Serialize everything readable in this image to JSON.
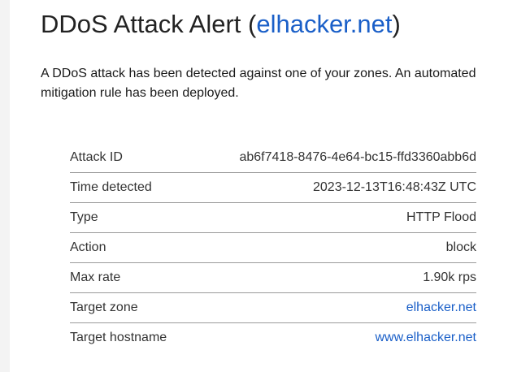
{
  "header": {
    "title_prefix": "DDoS Attack Alert (",
    "title_link": "elhacker.net",
    "title_suffix": ")"
  },
  "intro": "A DDoS attack has been detected against one of your zones. An automated mitigation rule has been deployed.",
  "details": [
    {
      "label": "Attack ID",
      "value": "ab6f7418-8476-4e64-bc15-ffd3360abb6d"
    },
    {
      "label": "Time detected",
      "value": "2023-12-13T16:48:43Z UTC"
    },
    {
      "label": "Type",
      "value": "HTTP Flood"
    },
    {
      "label": "Action",
      "value": "block"
    },
    {
      "label": "Max rate",
      "value": "1.90k rps"
    },
    {
      "label": "Target zone",
      "value": "elhacker.net"
    },
    {
      "label": "Target hostname",
      "value": "www.elhacker.net"
    }
  ],
  "colors": {
    "link": "#1a5fc8",
    "text": "#222222",
    "divider": "#9a9a9a",
    "page_background": "#f3f3f3"
  }
}
